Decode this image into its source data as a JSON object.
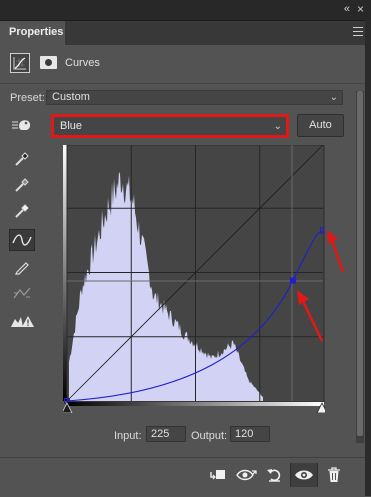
{
  "window": {
    "collapse_glyph": "«",
    "close_glyph": "×"
  },
  "tabs": [
    {
      "label": "Properties"
    }
  ],
  "header": {
    "icon_left": "curves-adjustment-icon",
    "icon_right": "layer-mask-icon",
    "title": "Curves"
  },
  "preset": {
    "label": "Preset:",
    "value": "Custom"
  },
  "channel": {
    "value": "Blue",
    "highlight_color": "#e01818"
  },
  "auto_button": {
    "label": "Auto"
  },
  "tools": [
    {
      "name": "target-adjust-hand-icon"
    },
    {
      "name": "black-point-eyedropper-icon"
    },
    {
      "name": "gray-point-eyedropper-icon"
    },
    {
      "name": "white-point-eyedropper-icon"
    },
    {
      "name": "curve-points-icon",
      "selected": true
    },
    {
      "name": "pencil-draw-icon"
    },
    {
      "name": "smooth-curve-icon"
    },
    {
      "name": "clipping-warning-icon"
    }
  ],
  "curve": {
    "channel_color": "#1e1ed2",
    "histogram_color": "#d2d2f5",
    "points": [
      [
        0,
        0
      ],
      [
        225,
        120
      ],
      [
        255,
        170
      ]
    ],
    "selected_point": [
      225,
      120
    ]
  },
  "input": {
    "label": "Input:",
    "value": "225"
  },
  "output": {
    "label": "Output:",
    "value": "120"
  },
  "bottom_icons": [
    {
      "name": "clip-to-layer-icon"
    },
    {
      "name": "view-previous-state-icon"
    },
    {
      "name": "reset-adjustments-icon"
    },
    {
      "name": "toggle-visibility-icon",
      "selected": true
    },
    {
      "name": "delete-adjustment-icon"
    }
  ],
  "annotation_color": "#e01818"
}
